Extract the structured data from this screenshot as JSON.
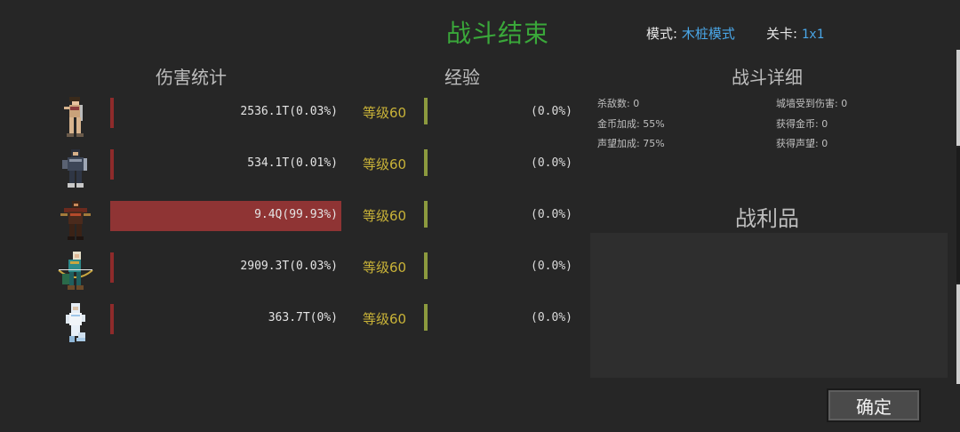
{
  "header": {
    "title": "战斗结束",
    "mode_label": "模式:",
    "mode_value": "木桩模式",
    "stage_label": "关卡:",
    "stage_value": "1x1"
  },
  "sections": {
    "damage": "伤害统计",
    "exp": "经验",
    "detail": "战斗详细",
    "loot": "战利品"
  },
  "heroes": [
    {
      "icon": "female-warrior-sprite-icon",
      "damage": "2536.1T(0.03%)",
      "damage_share": 0.0003,
      "level": "等级60",
      "exp": "(0.0%)"
    },
    {
      "icon": "armored-knight-sprite-icon",
      "damage": "534.1T(0.01%)",
      "damage_share": 0.0001,
      "level": "等级60",
      "exp": "(0.0%)"
    },
    {
      "icon": "dark-assassin-sprite-icon",
      "damage": "9.4Q(99.93%)",
      "damage_share": 0.9993,
      "level": "等级60",
      "exp": "(0.0%)"
    },
    {
      "icon": "elf-archer-sprite-icon",
      "damage": "2909.3T(0.03%)",
      "damage_share": 0.0003,
      "level": "等级60",
      "exp": "(0.0%)"
    },
    {
      "icon": "white-mage-sprite-icon",
      "damage": "363.7T(0%)",
      "damage_share": 0,
      "level": "等级60",
      "exp": "(0.0%)"
    }
  ],
  "details": {
    "kills": "杀敌数: 0",
    "wall_damage": "城墙受到伤害: 0",
    "gold_bonus": "金币加成: 55%",
    "gold_gained": "获得金币: 0",
    "fame_bonus": "声望加成: 75%",
    "fame_gained": "获得声望: 0"
  },
  "buttons": {
    "confirm": "确定"
  },
  "colors": {
    "title": "#3aa83a",
    "value_link": "#4aa7e8",
    "level": "#c9b338",
    "damage_bar": "#8f3434"
  }
}
